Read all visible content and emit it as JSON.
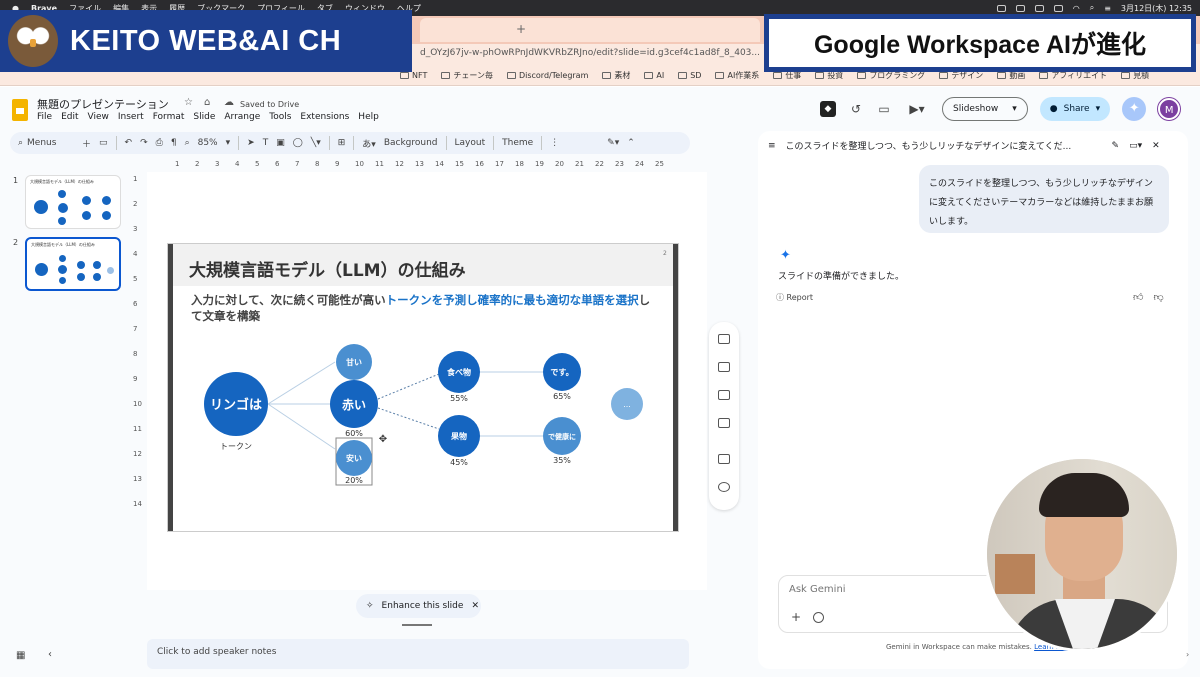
{
  "menubar": {
    "app": "Brave",
    "items": [
      "ファイル",
      "編集",
      "表示",
      "履歴",
      "ブックマーク",
      "プロフィール",
      "タブ",
      "ウィンドウ",
      "ヘルプ"
    ],
    "clock": "3月12日(木) 12:35"
  },
  "browser": {
    "url": "d_OYzJ67jv-w-phOwRPnJdWKVRbZRJno/edit?slide=id.g3cef4c1ad8f_8_403...",
    "new_tab": "+",
    "bookmarks": [
      "NFT",
      "チェーン毎",
      "Discord/Telegram",
      "素材",
      "AI",
      "SD",
      "AI作業系",
      "仕事",
      "投資",
      "プログラミング",
      "デザイン",
      "動画",
      "アフィリエイト",
      "見積"
    ]
  },
  "overlay": {
    "channel": "KEITO WEB&AI CH",
    "headline": "Google Workspace AIが進化"
  },
  "doc": {
    "title": "無題のプレゼンテーション",
    "saved": "Saved to Drive",
    "menu": [
      "File",
      "Edit",
      "View",
      "Insert",
      "Format",
      "Slide",
      "Arrange",
      "Tools",
      "Extensions",
      "Help"
    ]
  },
  "header_actions": {
    "slideshow": "Slideshow",
    "share": "Share",
    "avatar_initial": "M"
  },
  "toolbar": {
    "menus": "Menus",
    "zoom": "85%",
    "background": "Background",
    "layout": "Layout",
    "theme": "Theme"
  },
  "filmstrip": {
    "slides": [
      {
        "num": "1",
        "title": "大規模言語モデル（LLM）の仕組み"
      },
      {
        "num": "2",
        "title": "大規模言語モデル（LLM）の仕組み"
      }
    ]
  },
  "ruler": {
    "h_ticks": [
      "1",
      "2",
      "3",
      "4",
      "5",
      "6",
      "7",
      "8",
      "9",
      "10",
      "11",
      "12",
      "13",
      "14",
      "15",
      "16",
      "17",
      "18",
      "19",
      "20",
      "21",
      "22",
      "23",
      "24",
      "25"
    ],
    "v_ticks": [
      "1",
      "2",
      "3",
      "4",
      "5",
      "6",
      "7",
      "8",
      "9",
      "10",
      "11",
      "12",
      "13",
      "14"
    ]
  },
  "slide": {
    "title": "大規模言語モデル（LLM）の仕組み",
    "page_num": "2",
    "subtitle_pre": "入力に対して、次に続く可能性が高い",
    "subtitle_hl": "トークンを予測し確率的に最も適切な単語を選択",
    "subtitle_post": "して文章を構築",
    "nodes": {
      "input": "リンゴは",
      "input_caption": "トークン",
      "sweet": "甘い",
      "red": "赤い",
      "red_pct": "60%",
      "cheap": "安い",
      "cheap_pct": "20%",
      "food": "食べ物",
      "food_pct": "55%",
      "fruit": "果物",
      "fruit_pct": "45%",
      "desu": "です。",
      "desu_pct": "65%",
      "healthy": "で健康に",
      "healthy_pct": "35%",
      "more": "..."
    }
  },
  "enhance": {
    "label": "Enhance this slide"
  },
  "notes": {
    "placeholder": "Click to add speaker notes"
  },
  "gemini": {
    "thread_title": "このスライドを整理しつつ、もう少しリッチなデザインに変えてくだ...",
    "user_message": "このスライドを整理しつつ、もう少しリッチなデザインに変えてくださいテーマカラーなどは維持したままお願いします。",
    "reply": "スライドの準備ができました。",
    "report": "Report",
    "ask_placeholder": "Ask Gemini",
    "disclaimer": "Gemini in Workspace can make mistakes.",
    "learn_more": "Learn more"
  },
  "colors": {
    "accent": "#0b57d0",
    "node_dark": "#1565c0",
    "node_mid": "#4a8fd0",
    "node_light": "#7fb2e0",
    "highlight": "#1a73c8",
    "banner": "#1d3f8f"
  }
}
